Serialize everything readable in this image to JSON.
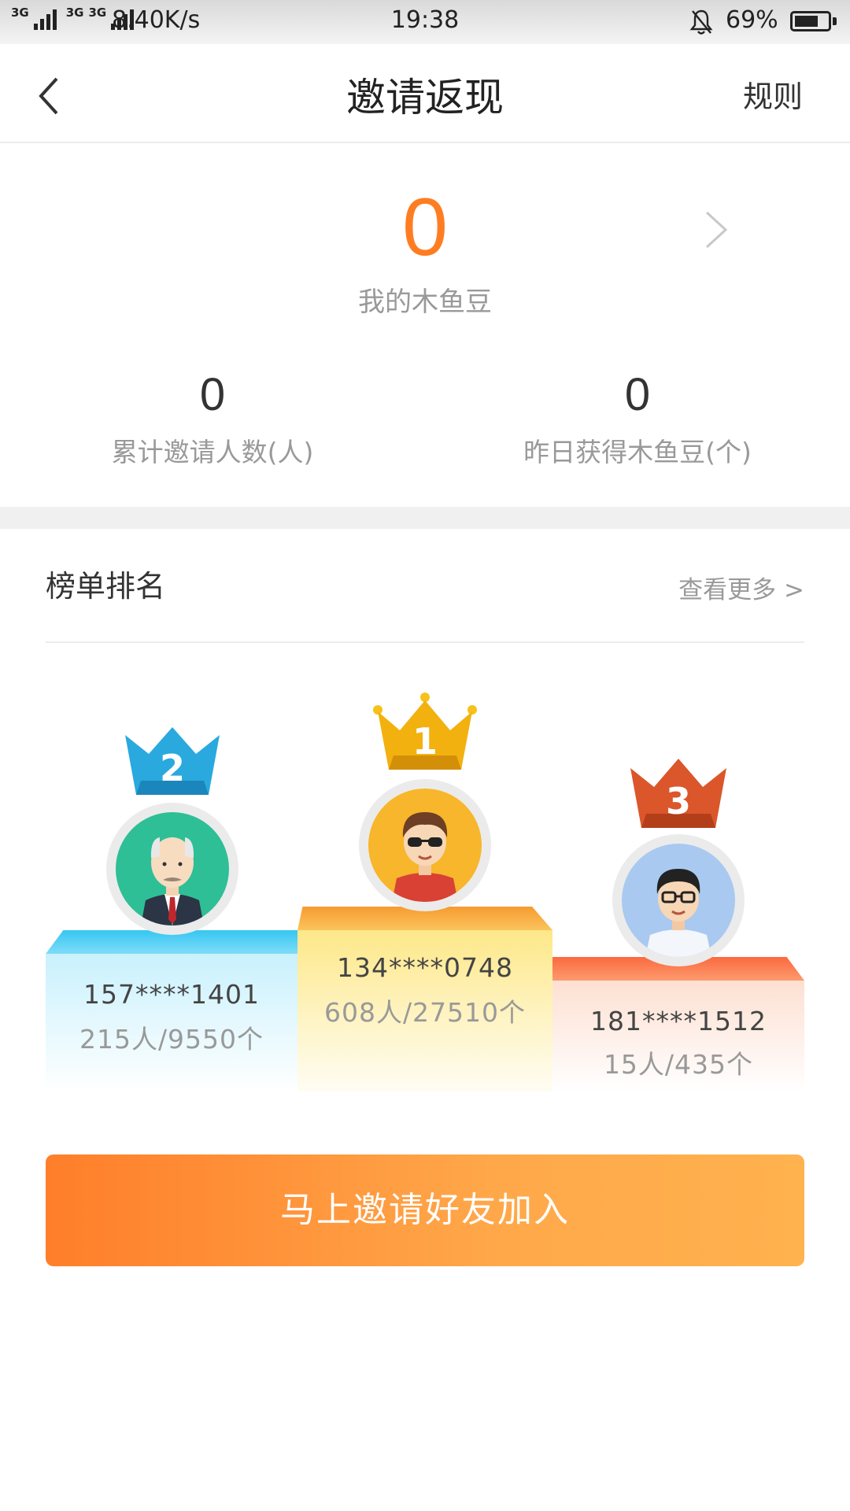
{
  "status_bar": {
    "net_tag_1": "3G",
    "net_tag_2": "3G",
    "net_tag_3": "3G",
    "speed": "8.40K/s",
    "time": "19:38",
    "battery": "69%",
    "battery_level": 0.69
  },
  "nav": {
    "back_icon": "chevron-left-icon",
    "title": "邀请返现",
    "rule_label": "规则"
  },
  "beans": {
    "count": "0",
    "label": "我的木鱼豆"
  },
  "stats": {
    "invited_count": "0",
    "invited_label": "累计邀请人数(人)",
    "yesterday_count": "0",
    "yesterday_label": "昨日获得木鱼豆(个)"
  },
  "ranking": {
    "title": "榜单排名",
    "more": "查看更多 >",
    "entries": [
      {
        "rank": "2",
        "phone": "157****1401",
        "count": "215人/9550个",
        "crown_color": "#26a6dc"
      },
      {
        "rank": "1",
        "phone": "134****0748",
        "count": "608人/27510个",
        "crown_color": "#f2b10f"
      },
      {
        "rank": "3",
        "phone": "181****1512",
        "count": "15人/435个",
        "crown_color": "#d9542a"
      }
    ]
  },
  "invite_button": {
    "label": "马上邀请好友加入"
  },
  "colors": {
    "accent": "#ff7d22",
    "button_start": "#ff7e2a",
    "button_end": "#ffb24e"
  }
}
